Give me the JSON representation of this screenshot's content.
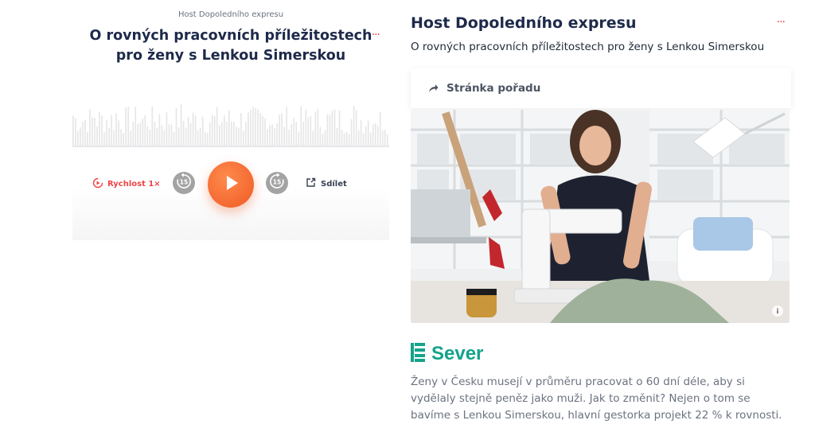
{
  "player": {
    "host": "Host Dopoledního expresu",
    "title": "O rovných pracovních příležitostech pro ženy s Lenkou Simerskou",
    "more": "···",
    "speed_label": "Rychlost 1×",
    "skip_back_label": "15",
    "skip_forward_label": "15",
    "share_label": "Sdílet",
    "accent_color": "#ef5a24"
  },
  "article": {
    "title": "Host Dopoledního expresu",
    "more": "···",
    "subtitle": "O rovných pracovních příležitostech pro ženy s Lenkou Simerskou",
    "show_page_label": "Stránka pořadu",
    "station": "Sever",
    "station_color": "#14a38b",
    "description": "Ženy v Česku musejí v průměru pracovat o 60 dní déle, aby si vydělaly stejně peněz jako muži. Jak to změnit? Nejen o tom se bavíme s Lenkou Simerskou, hlavní gestorka projekt 22 % k rovnosti."
  },
  "icons": {
    "speed": "speed-icon",
    "skip_back": "rewind-15-icon",
    "play": "play-icon",
    "skip_forward": "forward-15-icon",
    "share": "share-icon",
    "show_page": "arrow-icon",
    "info": "info-icon",
    "station_logo": "station-logo-icon"
  }
}
